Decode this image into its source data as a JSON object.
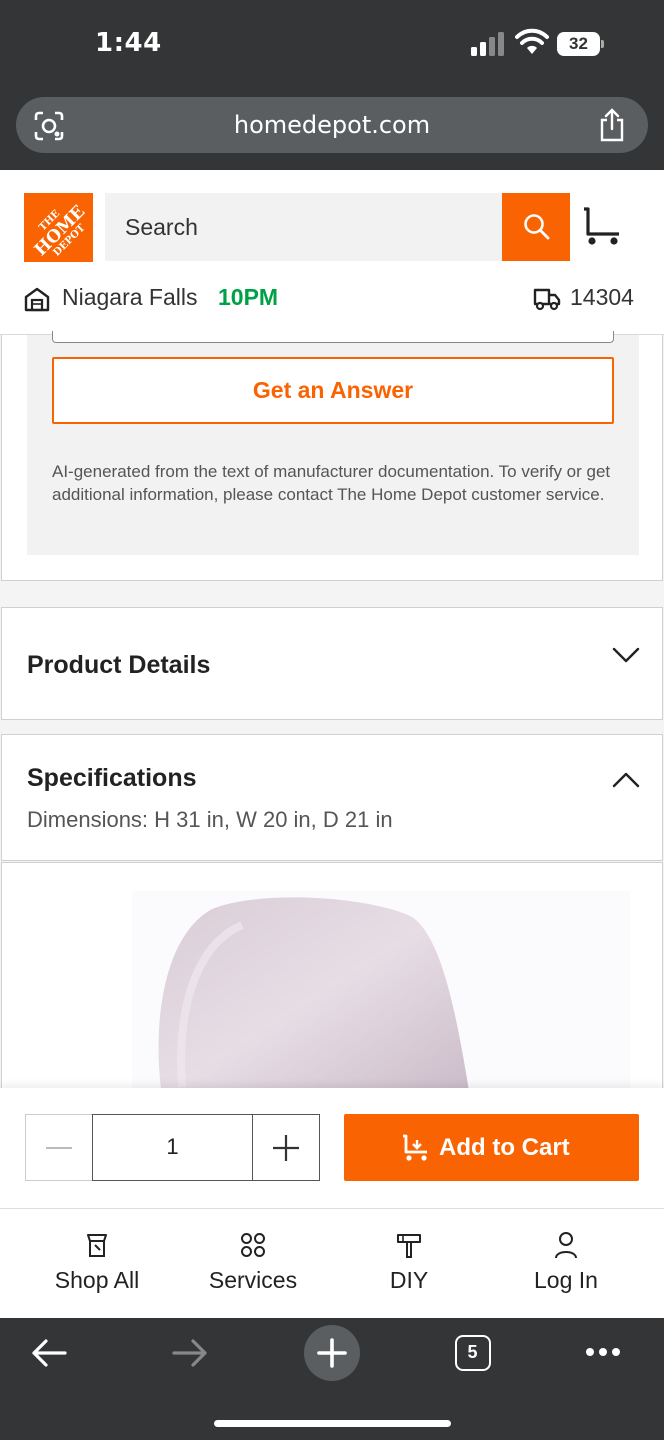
{
  "status_bar": {
    "time": "1:44",
    "battery": "32"
  },
  "browser": {
    "url": "homedepot.com",
    "tab_count": "5"
  },
  "header": {
    "logo_text": [
      "THE",
      "HOME",
      "DEPOT"
    ],
    "search_placeholder": "Search",
    "store_name": "Niagara Falls",
    "store_hours": "10PM",
    "zip": "14304"
  },
  "qa": {
    "button_label": "Get an Answer",
    "disclaimer": "AI-generated from the text of manufacturer documentation. To verify or get additional information, please contact The Home Depot customer service."
  },
  "accordions": {
    "product_details": "Product Details",
    "specifications": "Specifications",
    "specifications_summary": "Dimensions: H 31 in, W 20 in, D 21 in"
  },
  "cart_bar": {
    "quantity": "1",
    "add_label": "Add to Cart"
  },
  "bottom_nav": [
    {
      "label": "Shop All",
      "icon": "shop-all-icon"
    },
    {
      "label": "Services",
      "icon": "services-icon"
    },
    {
      "label": "DIY",
      "icon": "diy-icon"
    },
    {
      "label": "Log In",
      "icon": "user-icon"
    }
  ],
  "colors": {
    "brand": "#f96302",
    "open_hours": "#00a046",
    "chrome": "#333537"
  }
}
